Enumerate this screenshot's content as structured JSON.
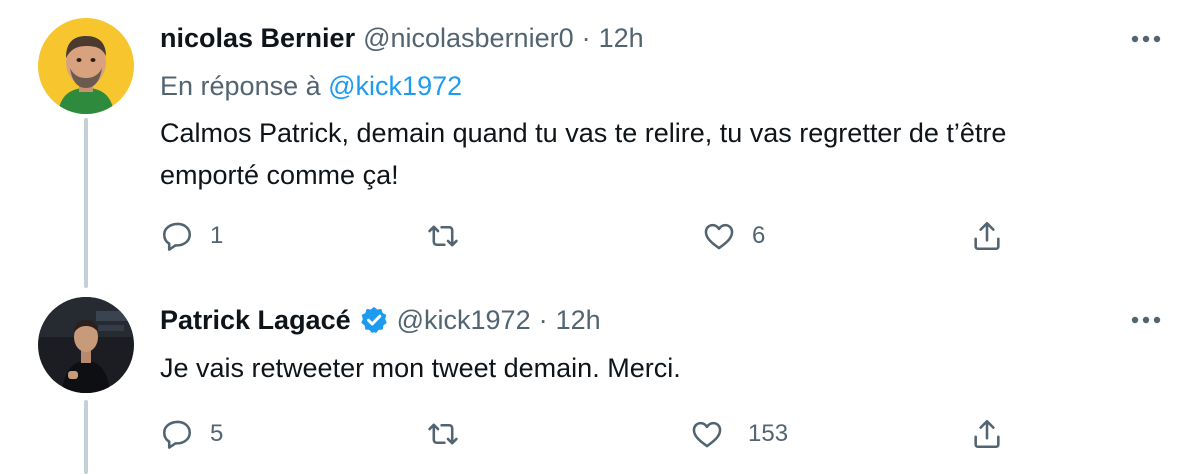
{
  "tweets": [
    {
      "name": "nicolas Bernier",
      "handle": "@nicolasbernier0",
      "separator": "·",
      "time": "12h",
      "reply_prefix": "En réponse à",
      "reply_handle": "@kick1972",
      "text_line1": "Calmos Patrick, demain quand tu vas te relire, tu vas regretter de t’être",
      "text_line2": "emporté comme ça!",
      "reply_count": "1",
      "retweet_count": "",
      "like_count": "6"
    },
    {
      "name": "Patrick Lagacé",
      "verified": true,
      "handle": "@kick1972",
      "separator": "·",
      "time": "12h",
      "text_line1": "Je vais retweeter mon tweet demain. Merci.",
      "reply_count": "5",
      "retweet_count": "",
      "like_count": "153"
    }
  ],
  "colors": {
    "text": "#0f1419",
    "secondary": "#536471",
    "link": "#1d9bf0",
    "thread_line": "#c4cfd6",
    "avatar1_bg": "#f7c52e",
    "avatar2_bg": "#1b1d22"
  },
  "icons": [
    "reply-icon",
    "retweet-icon",
    "like-icon",
    "share-icon",
    "more-icon",
    "verified-badge-icon"
  ]
}
